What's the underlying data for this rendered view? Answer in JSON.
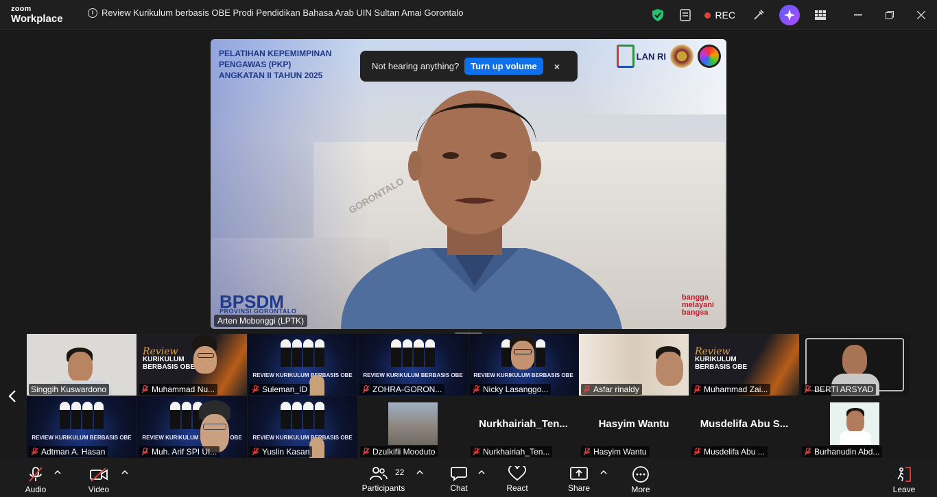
{
  "app": {
    "brand_line1": "zoom",
    "brand_line2": "Workplace",
    "meeting_title": "Review Kurikulum berbasis OBE Prodi Pendidikan Bahasa Arab UIN Sultan Amai Gorontalo",
    "rec_label": "REC"
  },
  "toast": {
    "message": "Not hearing anything?",
    "action": "Turn up volume",
    "close": "×"
  },
  "active_speaker": {
    "name": "Arten Mobonggi (LPTK)",
    "banner_line1": "PELATIHAN KEPEMIMPINAN",
    "banner_line2": "PENGAWAS (PKP)",
    "banner_line3": "ANGKATAN II TAHUN 2025",
    "org": "BPSDM",
    "org_sub": "PROVINSI GORONTALO",
    "logo_text": "LAN RI",
    "slogan1": "bangga",
    "slogan2": "melayani",
    "slogan3": "bangsa",
    "building_text": "GORONTALO"
  },
  "gallery": [
    {
      "name": "Singgih Kuswardono",
      "muted": false
    },
    {
      "name": "Muhammad Nu...",
      "muted": true
    },
    {
      "name": "Suleman_ID",
      "muted": true
    },
    {
      "name": "ZOHRA-GORON...",
      "muted": true
    },
    {
      "name": "Nicky Lasanggo...",
      "muted": true
    },
    {
      "name": "Asfar rinaldy",
      "muted": true
    },
    {
      "name": "Muhammad Zai...",
      "muted": true
    },
    {
      "name": "BERTI ARSYAD",
      "muted": true
    },
    {
      "name": "Adtman A. Hasan",
      "muted": true
    },
    {
      "name": "Muh. Arif SPI UI...",
      "muted": true
    },
    {
      "name": "Yuslin Kasan",
      "muted": true
    },
    {
      "name": "Dzulkifli Mooduto",
      "muted": true
    },
    {
      "name": "Nurkhairiah_Ten...",
      "muted": true,
      "display": "Nurkhairiah_Ten..."
    },
    {
      "name": "Hasyim Wantu",
      "muted": true,
      "display": "Hasyim Wantu"
    },
    {
      "name": "Musdelifa Abu ...",
      "muted": true,
      "display": "Musdelifa Abu S..."
    },
    {
      "name": "Burhanudin Abd...",
      "muted": true
    }
  ],
  "poster_text": "REVIEW KURIKULUM BERBASIS OBE",
  "poster2": {
    "script": "Review",
    "line1": "KURIKULUM",
    "line2": "BERBASIS OBE"
  },
  "toolbar": {
    "audio": "Audio",
    "video": "Video",
    "participants": "Participants",
    "participants_count": "22",
    "chat": "Chat",
    "react": "React",
    "share": "Share",
    "more": "More",
    "leave": "Leave"
  },
  "colors": {
    "accent": "#0e71eb",
    "rec": "#e0413a",
    "leave": "#e0413a",
    "mic_off": "#e0413a"
  }
}
